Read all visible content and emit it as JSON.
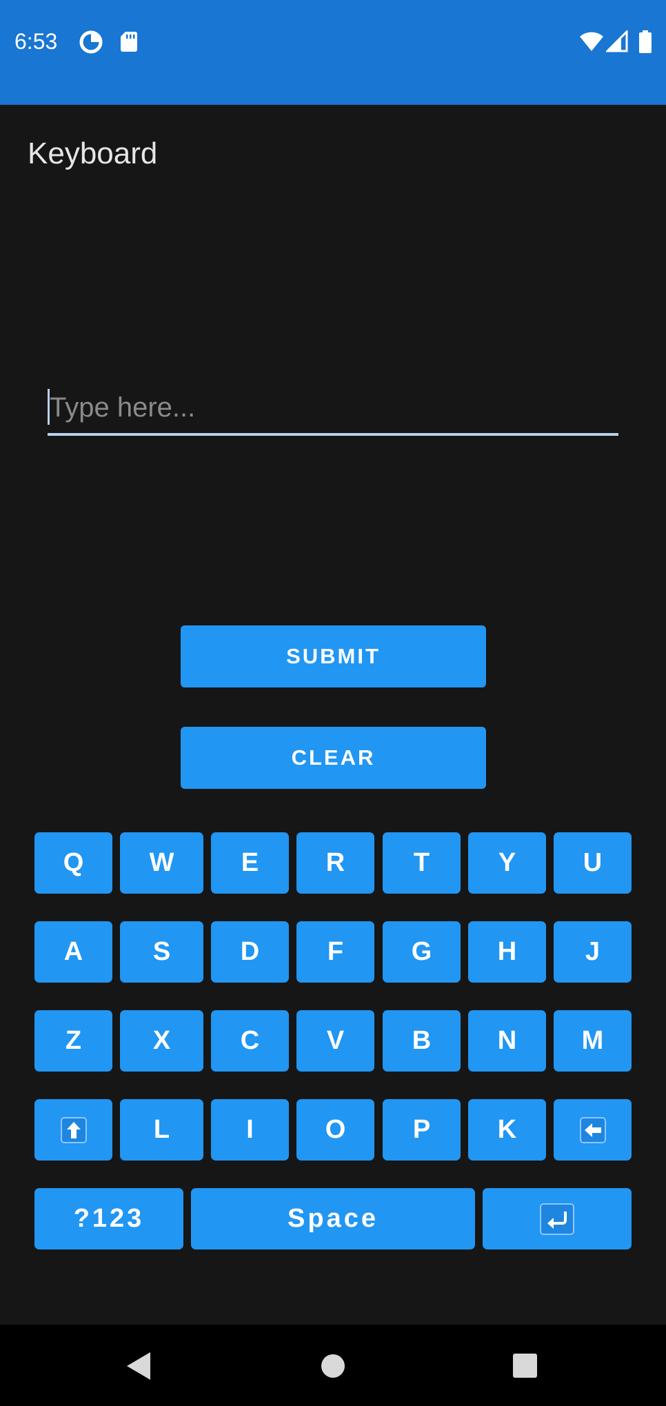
{
  "status_bar": {
    "time": "6:53",
    "left_icons": [
      "data-saver-icon",
      "sd-card-icon"
    ],
    "right_icons": [
      "wifi-icon",
      "cell-signal-icon",
      "battery-icon"
    ],
    "background_color": "#1976d2"
  },
  "app": {
    "title": "Keyboard"
  },
  "input": {
    "placeholder": "Type here...",
    "value": ""
  },
  "buttons": {
    "submit": "SUBMIT",
    "clear": "CLEAR"
  },
  "keyboard": {
    "rows": [
      [
        "Q",
        "W",
        "E",
        "R",
        "T",
        "Y",
        "U"
      ],
      [
        "A",
        "S",
        "D",
        "F",
        "G",
        "H",
        "J"
      ],
      [
        "Z",
        "X",
        "C",
        "V",
        "B",
        "N",
        "M"
      ],
      [
        "shift-icon",
        "L",
        "I",
        "O",
        "P",
        "K",
        "backspace-icon"
      ]
    ],
    "bottom_row": {
      "symbols": "?123",
      "space": "Space",
      "enter": "enter-icon"
    },
    "key_color": "#2196f3"
  },
  "nav_bar": {
    "icons": [
      "back-icon",
      "home-icon",
      "recents-icon"
    ]
  }
}
